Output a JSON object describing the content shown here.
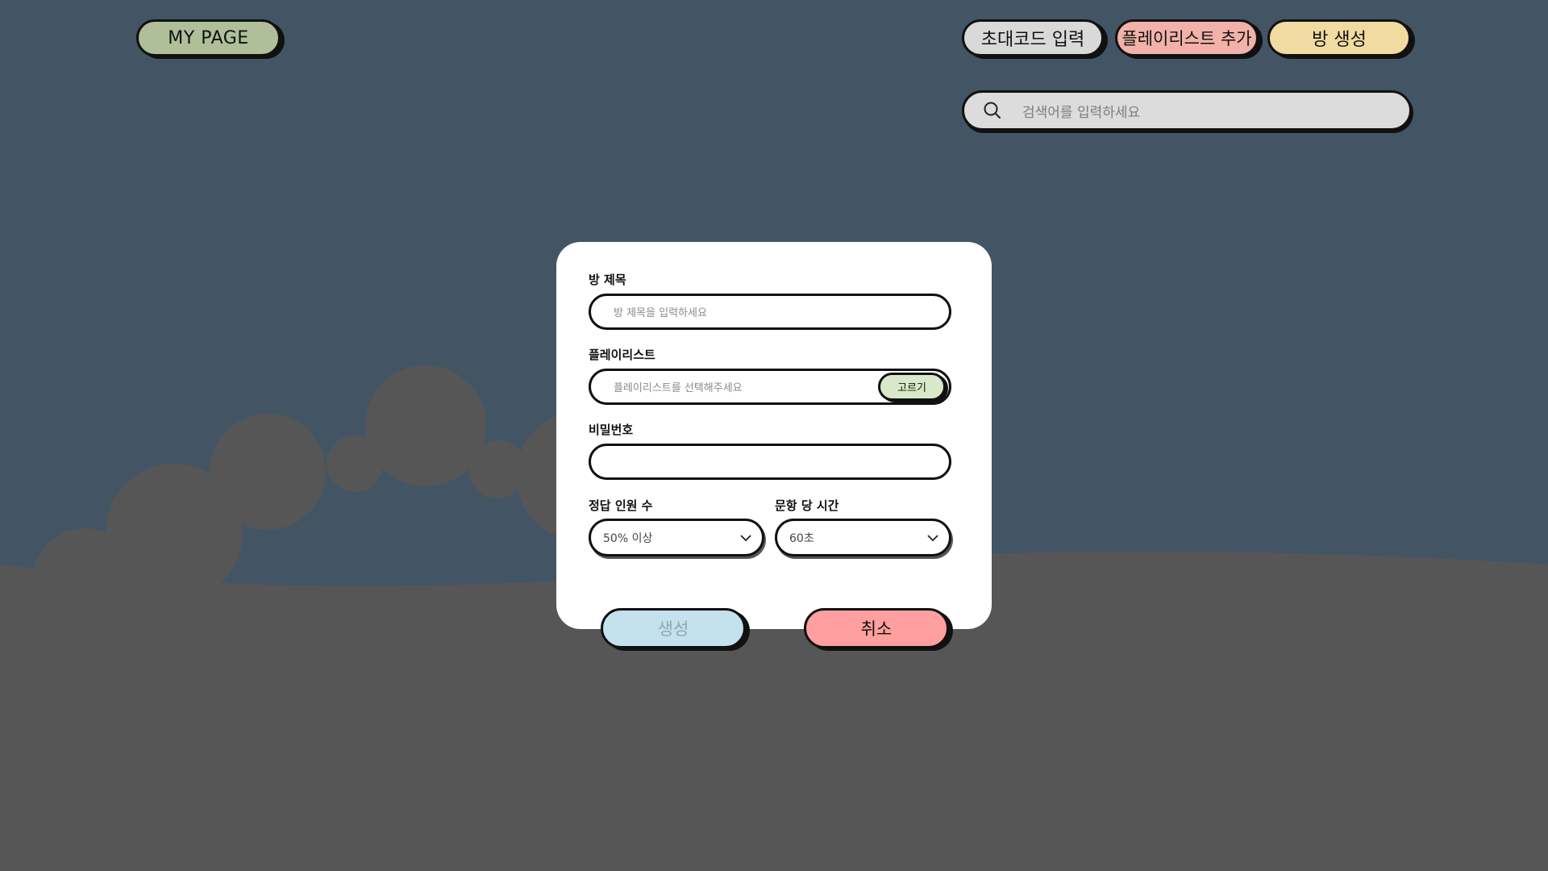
{
  "header": {
    "mypage_label": "MY PAGE",
    "invite_label": "초대코드 입력",
    "add_playlist_label": "플레이리스트 추가",
    "make_room_label": "방 생성"
  },
  "search": {
    "placeholder": "검색어를 입력하세요",
    "icon": "search-icon"
  },
  "modal": {
    "room_title": {
      "label": "방 제목",
      "placeholder": "방 제목을 입력하세요",
      "value": ""
    },
    "playlist": {
      "label": "플레이리스트",
      "placeholder": "플레이리스트를 선택해주세요",
      "pick_label": "고르기"
    },
    "password": {
      "label": "비밀번호",
      "value": ""
    },
    "answer_count": {
      "label": "정답 인원 수",
      "selected": "50% 이상"
    },
    "time_per_question": {
      "label": "문항 당 시간",
      "selected": "60초"
    },
    "create_label": "생성",
    "cancel_label": "취소"
  },
  "colors": {
    "mypage": "#aebf9a",
    "invite": "#d9d9d9",
    "add_playlist": "#f2b2a9",
    "make_room": "#f1dba1",
    "pick": "#d8e8c8",
    "create": "#c4e2ee",
    "cancel": "#ff9f9f",
    "overlay": "rgba(0,0,0,0.38)"
  }
}
